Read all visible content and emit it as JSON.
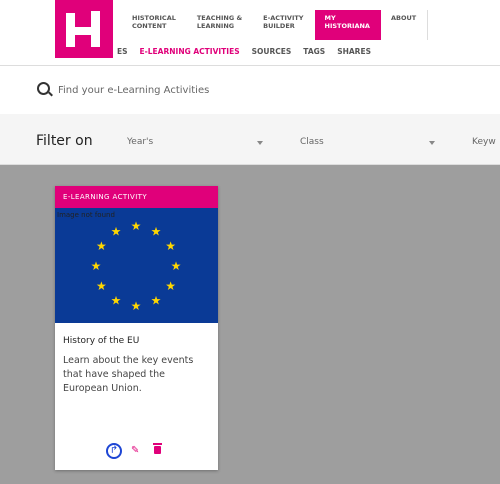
{
  "nav": {
    "items": [
      {
        "label": "HISTORICAL\nCONTENT"
      },
      {
        "label": "TEACHING &\nLEARNING"
      },
      {
        "label": "E-ACTIVITY\nBUILDER"
      },
      {
        "label": "MY\nHISTORIANA",
        "active": true
      },
      {
        "label": "ABOUT"
      }
    ]
  },
  "subnav": {
    "items": [
      {
        "label": "ES"
      },
      {
        "label": "E-LEARNING ACTIVITIES",
        "active": true
      },
      {
        "label": "SOURCES"
      },
      {
        "label": "TAGS"
      },
      {
        "label": "SHARES"
      }
    ]
  },
  "search": {
    "placeholder": "Find your e-Learning Activities"
  },
  "filter": {
    "label": "Filter on",
    "year": "Year's",
    "class": "Class",
    "keyword": "Keyw"
  },
  "card": {
    "tag": "E-LEARNING ACTIVITY",
    "image_alt": "Image not found",
    "title": "History of the EU",
    "description": "Learn about the key events that have shaped the European Union."
  },
  "icons": {
    "logo": "historiana-logo",
    "search": "search-icon",
    "share": "share-icon",
    "edit": "pencil-icon",
    "delete": "trash-icon"
  },
  "colors": {
    "brand": "#e0007a",
    "eu_blue": "#0a3a96",
    "eu_star": "#ffd700",
    "share": "#1e46d4",
    "backdrop": "#9e9e9e"
  }
}
